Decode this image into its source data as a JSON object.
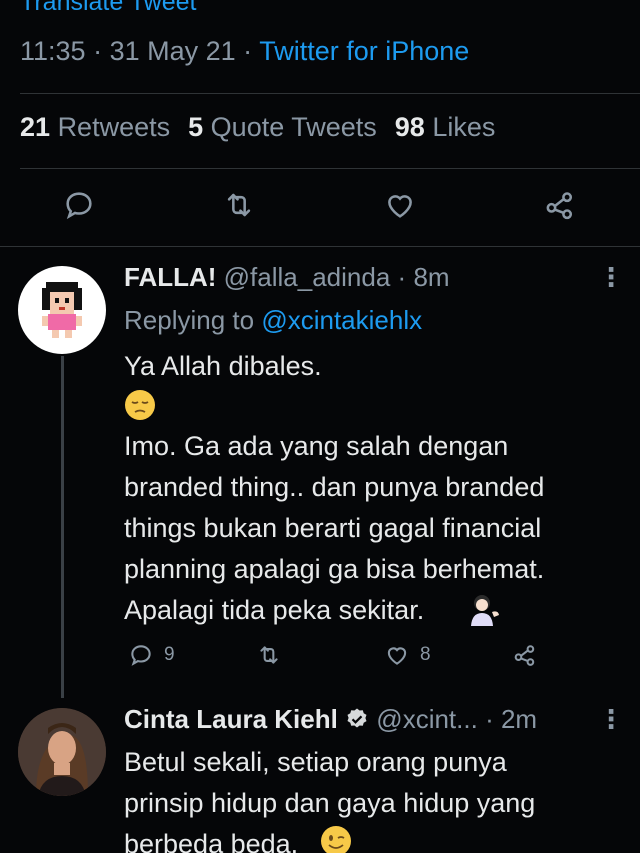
{
  "tweet": {
    "translate_label": "Translate Tweet",
    "time": "11:35",
    "date": "31 May 21",
    "source": "Twitter for iPhone",
    "stats": {
      "retweets_count": "21",
      "retweets_label": "Retweets",
      "quotes_count": "5",
      "quotes_label": "Quote Tweets",
      "likes_count": "98",
      "likes_label": "Likes"
    },
    "icons": [
      "reply-icon",
      "retweet-icon",
      "like-icon",
      "share-icon"
    ]
  },
  "replies": [
    {
      "name": "FALLA!",
      "handle": "@falla_adinda",
      "age": "8m",
      "replying_prefix": "Replying to",
      "replying_to": "@xcintakiehlx",
      "line1": "Ya Allah dibales.",
      "body": "Imo. Ga ada yang salah dengan\nbranded thing.. dan punya branded\nthings bukan berarti gagal financial\nplanning apalagi ga bisa berhemat.\nApalagi tida peka sekitar.",
      "reply_count": "9",
      "like_count": "8",
      "emojis": [
        "pensive-face-emoji",
        "tipping-hand-person-emoji"
      ]
    },
    {
      "name": "Cinta Laura Kiehl",
      "handle": "@xcint...",
      "age": "2m",
      "body": "Betul sekali, setiap orang punya\nprinsip hidup dan gaya hidup yang\nberbeda beda.",
      "emojis": [
        "winking-face-emoji"
      ]
    }
  ],
  "colors": {
    "background": "#050608",
    "link": "#1d9bf0",
    "secondary_text": "#8b98a5",
    "primary_text": "#e7e9ea"
  }
}
